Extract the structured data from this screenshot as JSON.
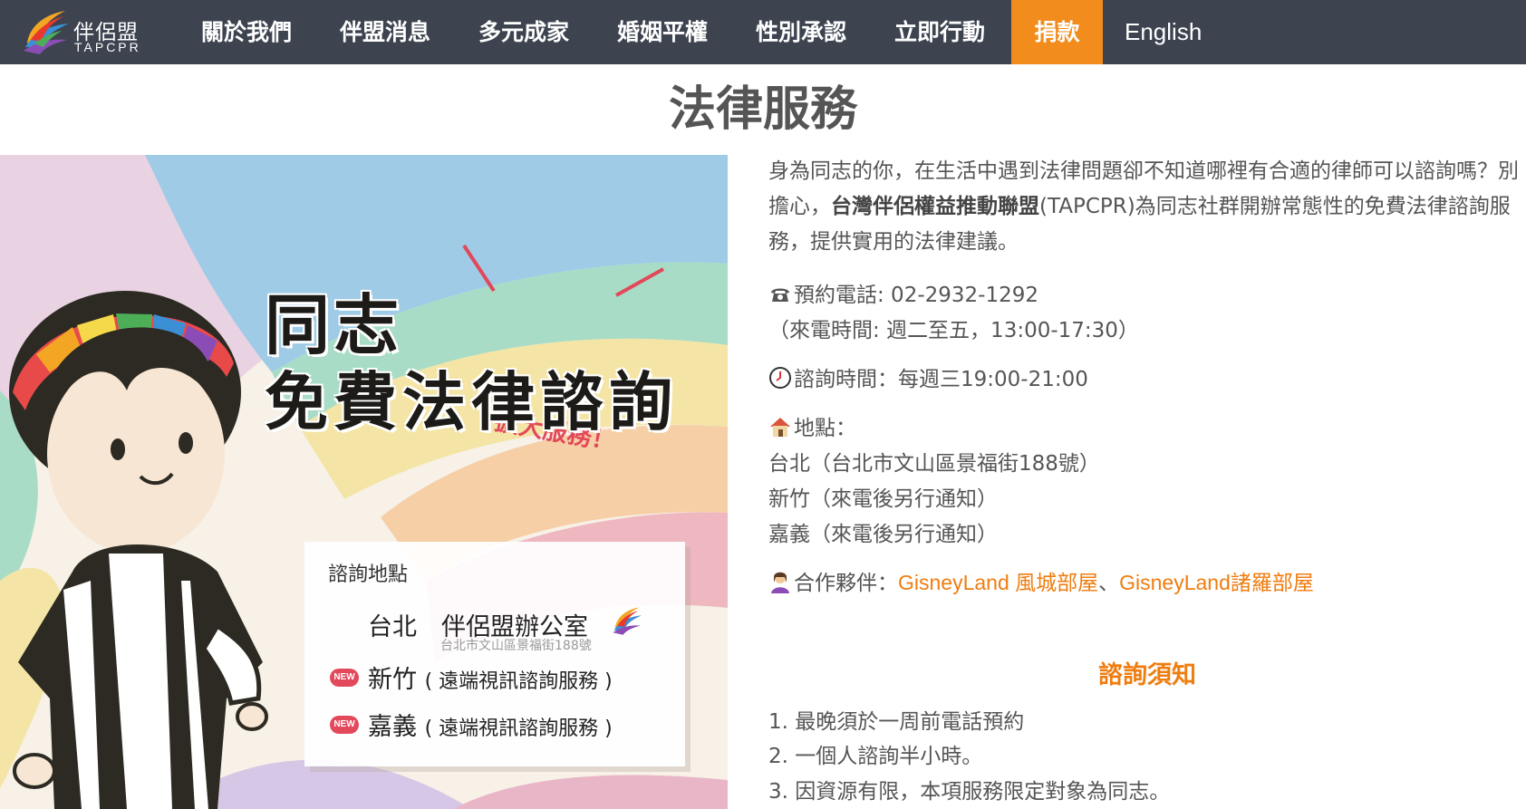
{
  "brand": {
    "name": "伴侶盟",
    "sub": "TAPCPR"
  },
  "nav": {
    "items": [
      {
        "label": "關於我們"
      },
      {
        "label": "伴盟消息"
      },
      {
        "label": "多元成家"
      },
      {
        "label": "婚姻平權"
      },
      {
        "label": "性別承認"
      },
      {
        "label": "立即行動"
      },
      {
        "label": "捐款"
      },
      {
        "label": "English"
      }
    ],
    "donate_color": "#f28c1c"
  },
  "page": {
    "title": "法律服務"
  },
  "poster": {
    "expand": "擴大服務！",
    "headline_line1": "同志",
    "headline_line2": "免費法律諮詢",
    "locations_title": "諮詢地點",
    "taipei": "台北　伴侶盟辦公室",
    "taipei_address": "台北市文山區景福街188號",
    "hsinchu": "新竹",
    "chiayi": "嘉義",
    "remote": "( 遠端視訊諮詢服務 )",
    "new_badge": "NEW"
  },
  "intro": {
    "before": "身為同志的你，在生活中遇到法律問題卻不知道哪裡有合適的律師可以諮詢嗎？別擔心，",
    "org": "台灣伴侶權益推動聯盟",
    "after": "(TAPCPR)為同志社群開辦常態性的免費法律諮詢服務，提供實用的法律建議。"
  },
  "contact": {
    "phone": "預約電話: 02-2932-1292",
    "phone_hours": "（來電時間: 週二至五，13:00-17:30）",
    "consult_time": "諮詢時間：每週三19:00-21:00",
    "location_label": "地點：",
    "locations": [
      "台北（台北市文山區景福街188號）",
      "新竹（來電後另行通知）",
      "嘉義（來電後另行通知）"
    ],
    "partners_label": "合作夥伴：",
    "partner1": "GisneyLand 風城部屋",
    "separator": "、",
    "partner2": "GisneyLand諸羅部屋",
    "link_color": "#ef7d10"
  },
  "notice": {
    "title": "諮詢須知",
    "items": [
      "1. 最晚須於一周前電話預約",
      "2. 一個人諮詢半小時。",
      "3. 因資源有限，本項服務限定對象為同志。"
    ]
  },
  "icons": [
    "phone-icon",
    "clock-icon",
    "house-icon",
    "partner-icon",
    "logo-icon"
  ]
}
